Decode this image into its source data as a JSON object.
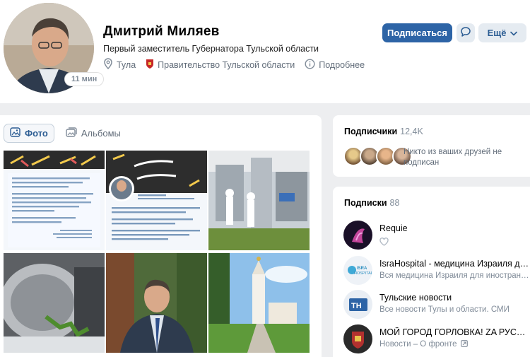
{
  "profile": {
    "name": "Дмитрий Миляев",
    "status": "Первый заместитель Губернатора Тульской области",
    "online": "11 мин",
    "city": "Тула",
    "organization": "Правительство Тульской области",
    "details_link": "Подробнее",
    "subscribe_label": "Подписаться",
    "more_label": "Ещё",
    "icons": [
      "location-icon",
      "coat-of-arms-icon",
      "info-icon",
      "message-icon",
      "chevron-down-icon"
    ]
  },
  "photos": {
    "tabs": [
      {
        "label": "Фото",
        "icon": "photo-icon",
        "active": true
      },
      {
        "label": "Альбомы",
        "icon": "album-icon",
        "active": false
      }
    ]
  },
  "subscribers": {
    "title": "Подписчики",
    "count": "12,4K",
    "note": "Никто из ваших друзей не подписан"
  },
  "following": {
    "title": "Подписки",
    "count": "88",
    "items": [
      {
        "name": "Requie",
        "desc": ""
      },
      {
        "name": "IsraHospital - медицина Израиля для иностранцев",
        "desc": "Вся медицина Израиля для иностранцев"
      },
      {
        "name": "Тульские новости",
        "desc": "Все новости Тулы и области. СМИ"
      },
      {
        "name": "МОЙ ГОРОД ГОРЛОВКА! ZA РУССКИЙ МИР!",
        "desc": "Новости – О фронте"
      }
    ]
  },
  "colors": {
    "accent": "#2d64a6",
    "link": "#2c5d93",
    "secondary_text": "#818c99",
    "background": "#edeef0"
  }
}
